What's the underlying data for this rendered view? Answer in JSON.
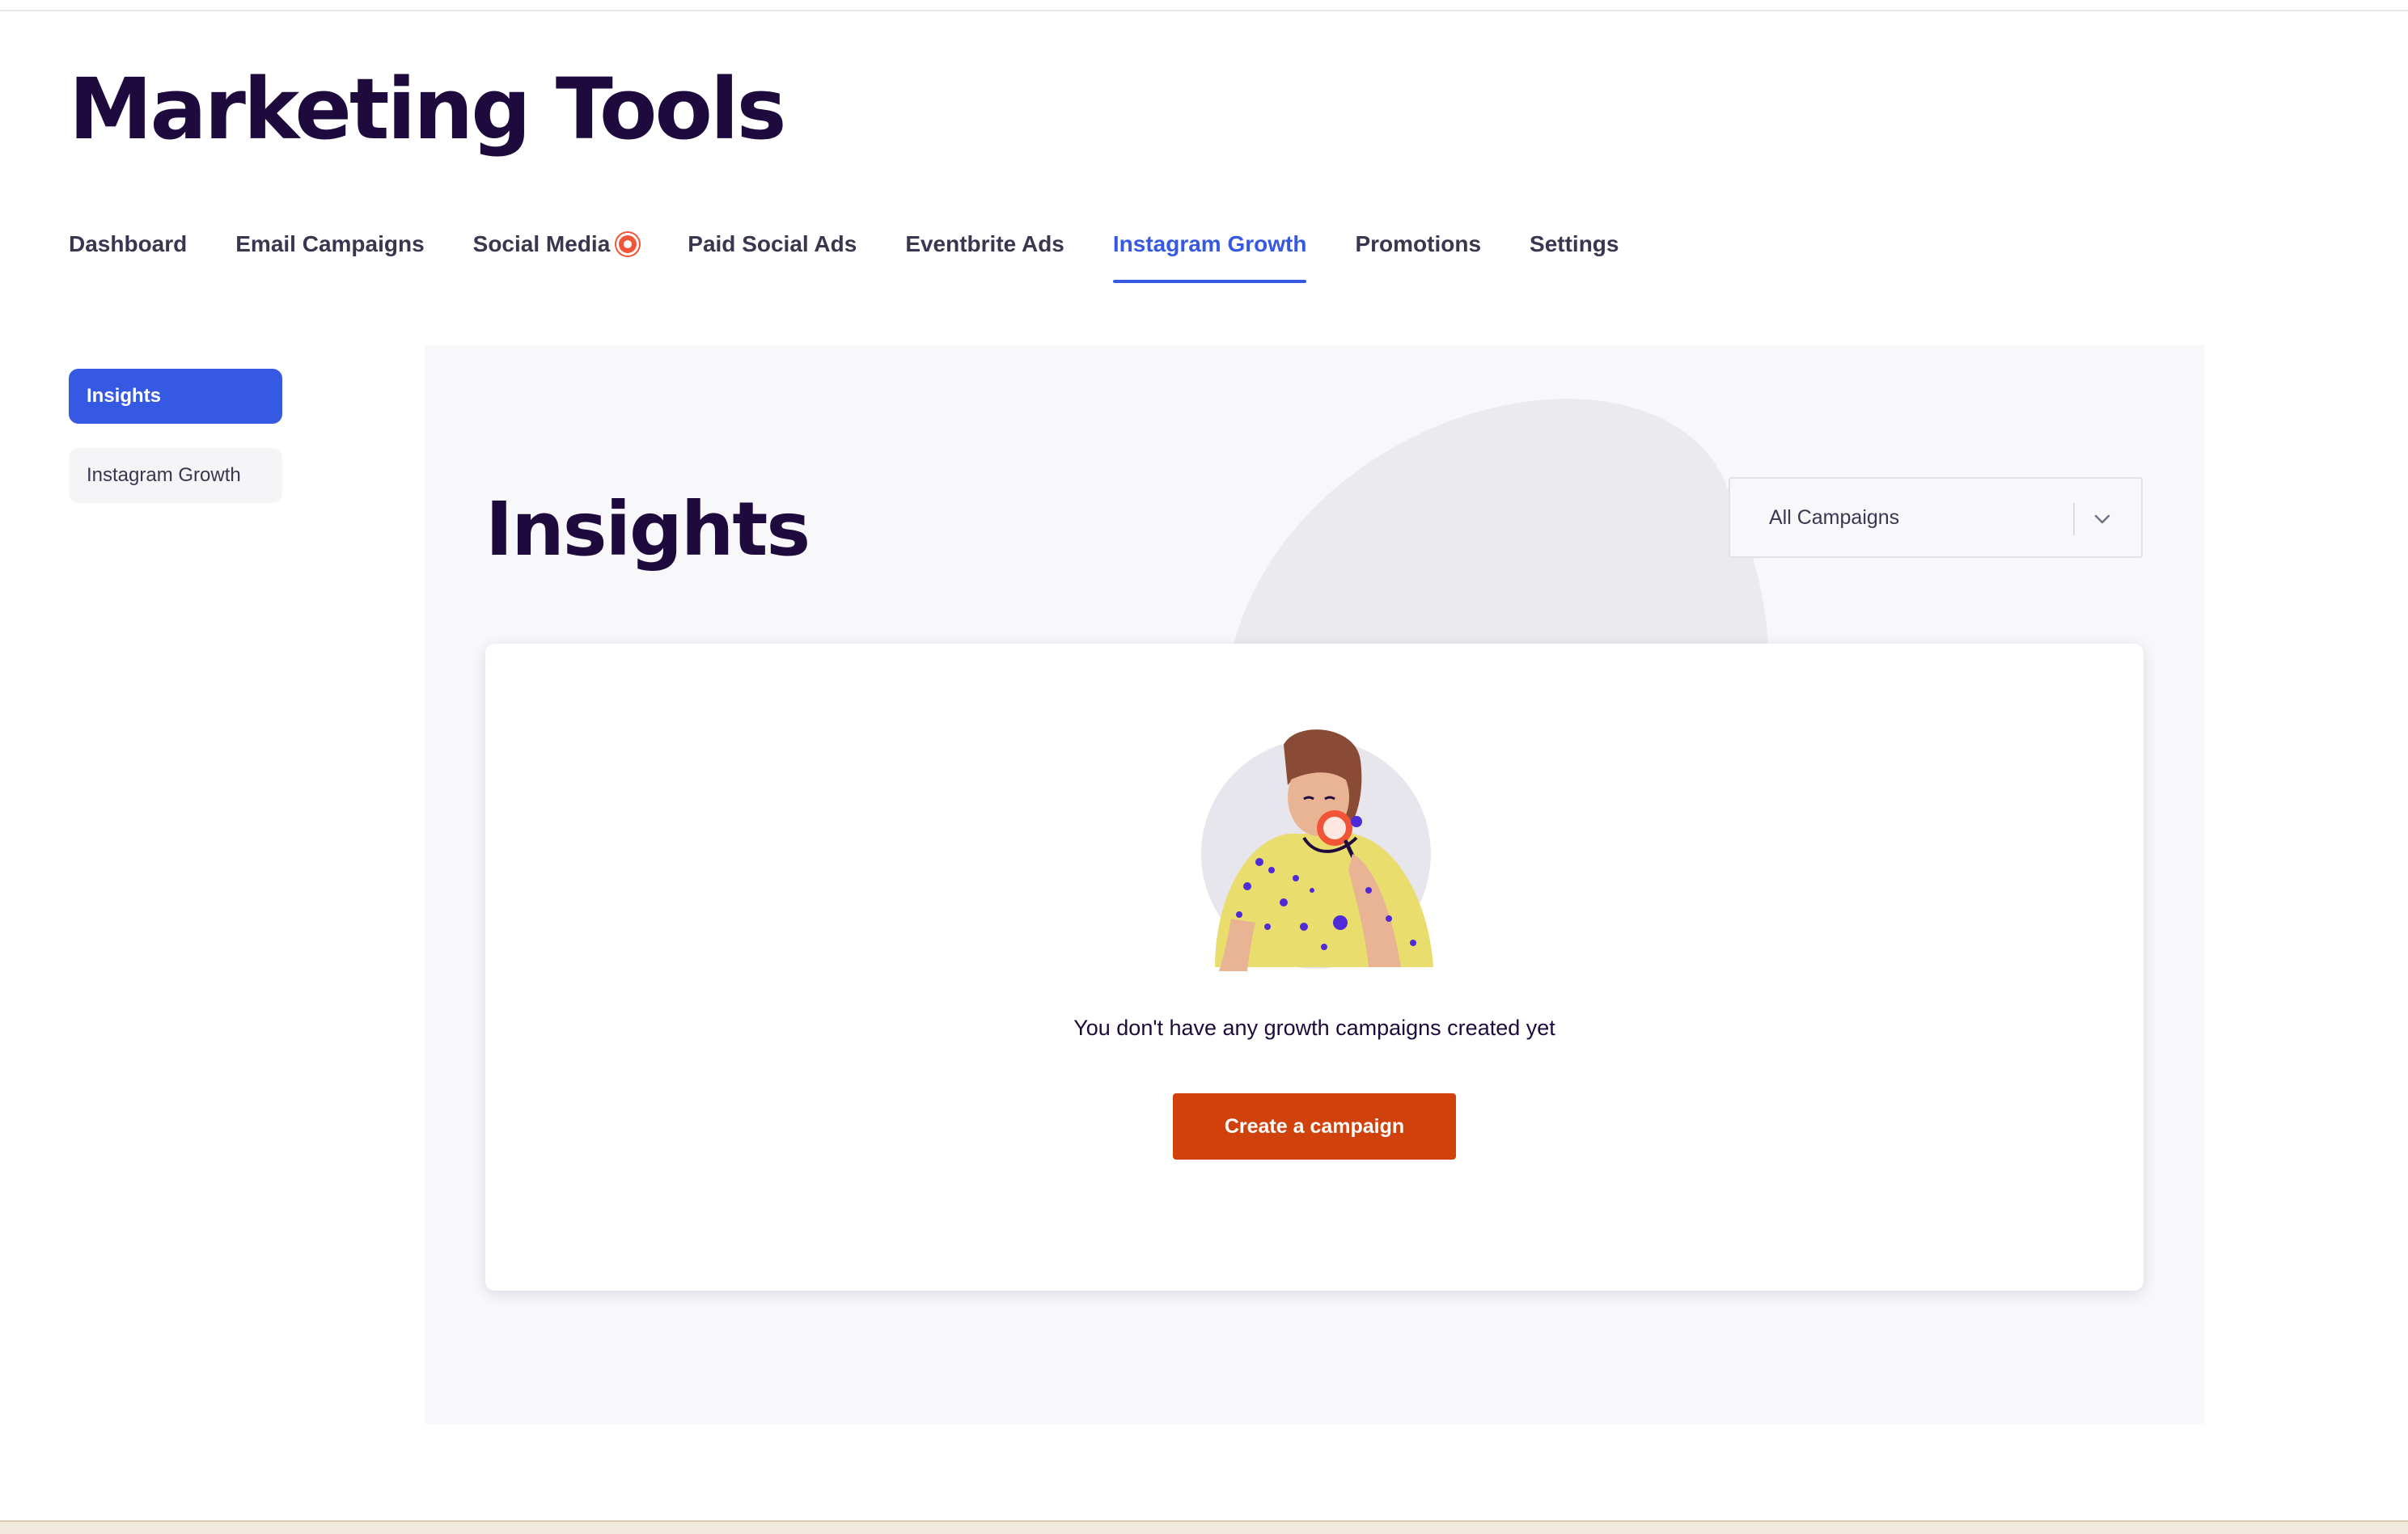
{
  "header": {
    "title": "Marketing Tools"
  },
  "tabs": [
    {
      "label": "Dashboard"
    },
    {
      "label": "Email Campaigns"
    },
    {
      "label": "Social Media",
      "has_badge": true
    },
    {
      "label": "Paid Social Ads"
    },
    {
      "label": "Eventbrite Ads"
    },
    {
      "label": "Instagram Growth",
      "active": true
    },
    {
      "label": "Promotions"
    },
    {
      "label": "Settings"
    }
  ],
  "sidebar": {
    "items": [
      {
        "label": "Insights",
        "active": true
      },
      {
        "label": "Instagram Growth",
        "active": false
      }
    ]
  },
  "main": {
    "title": "Insights",
    "filter": {
      "selected": "All Campaigns"
    },
    "empty_state": {
      "message": "You don't have any growth campaigns created yet",
      "button_label": "Create a campaign"
    }
  },
  "colors": {
    "brand_dark": "#1e0a3c",
    "accent_blue": "#3659e3",
    "cta_orange": "#d1410c",
    "badge_red": "#e42b56"
  },
  "icons": {
    "tab_badge": "notification-badge-icon",
    "select": "chevron-down-icon",
    "illustration": "person-with-magnifier-illustration"
  }
}
